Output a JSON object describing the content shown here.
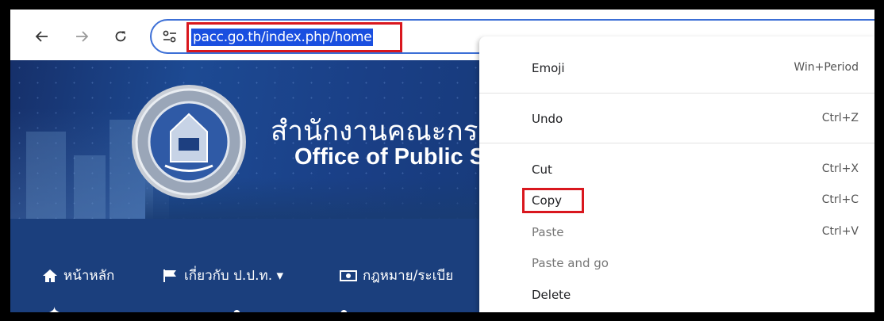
{
  "browser": {
    "url": "pacc.go.th/index.php/home",
    "back_icon": "arrow-left-icon",
    "forward_icon": "arrow-right-icon",
    "reload_icon": "reload-icon",
    "site_info_icon": "tune-icon"
  },
  "site": {
    "title_th": "สำนักงานคณะกร",
    "title_en": "Office of Public S",
    "nav": [
      {
        "icon": "home-icon",
        "label": "หน้าหลัก"
      },
      {
        "icon": "flag-icon",
        "label": "เกี่ยวกับ ป.ป.ท. ▾"
      },
      {
        "icon": "banknote-icon",
        "label": "กฎหมาย/ระเบีย"
      }
    ]
  },
  "context_menu": {
    "items": [
      {
        "label": "Emoji",
        "shortcut": "Win+Period",
        "dim": false
      },
      {
        "label": "Undo",
        "shortcut": "Ctrl+Z",
        "dim": false
      },
      {
        "label": "Cut",
        "shortcut": "Ctrl+X",
        "dim": false
      },
      {
        "label": "Copy",
        "shortcut": "Ctrl+C",
        "dim": false
      },
      {
        "label": "Paste",
        "shortcut": "Ctrl+V",
        "dim": true
      },
      {
        "label": "Paste and go",
        "shortcut": "",
        "dim": true
      },
      {
        "label": "Delete",
        "shortcut": "",
        "dim": false
      }
    ]
  },
  "colors": {
    "highlight_border": "#d9171e",
    "selection": "#1a4fe0",
    "site_bg": "#1b3f7d"
  }
}
